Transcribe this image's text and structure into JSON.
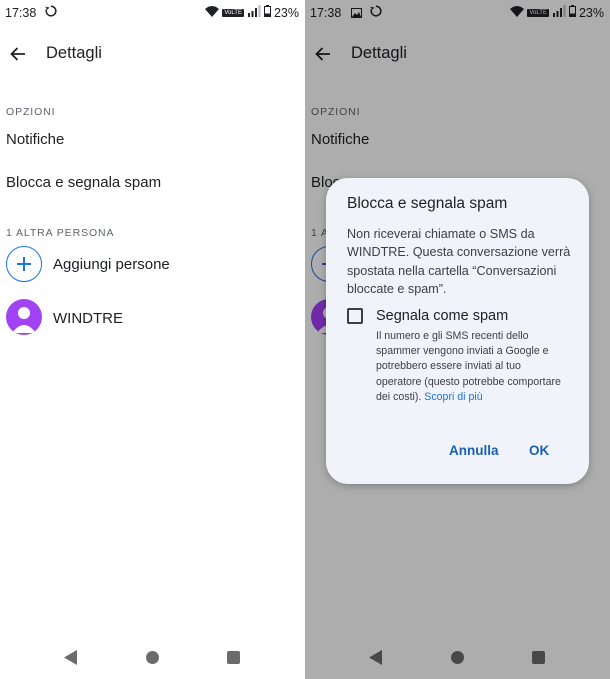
{
  "status_bar": {
    "time": "17:38",
    "battery": "23%",
    "volte": "VoLTE"
  },
  "app_bar": {
    "title": "Dettagli"
  },
  "options": {
    "section_label": "OPZIONI",
    "notifications_label": "Notifiche",
    "block_spam_label": "Blocca e segnala spam",
    "block_spam_partial": "Bloc"
  },
  "people": {
    "section_label": "1 ALTRA PERSONA",
    "section_label_partial": "1 A",
    "add_people_label": "Aggiungi persone",
    "contacts": [
      {
        "name": "WINDTRE"
      }
    ]
  },
  "dialog": {
    "title": "Blocca e segnala spam",
    "body": "Non riceverai chiamate o SMS da WINDTRE. Questa conversazione verrà spostata nella cartella “Conversazioni bloccate e spam”.",
    "report_label": "Segnala come spam",
    "report_checked": false,
    "report_description": "Il numero e gli SMS recenti dello spammer vengono inviati a Google e potrebbero essere inviati al tuo operatore (questo potrebbe comportare dei costi).",
    "learn_more": "Scopri di più",
    "cancel_label": "Annulla",
    "ok_label": "OK"
  },
  "colors": {
    "accent": "#1a73e8",
    "avatar": "#a142f4",
    "dialog_bg": "#f0f4fa",
    "scrim": "rgba(0,0,0,0.32)"
  },
  "icons": [
    "sync-icon",
    "image-icon",
    "wifi-icon",
    "signal-icon",
    "battery-icon",
    "back-arrow-icon",
    "add-icon",
    "person-icon",
    "nav-back-icon",
    "nav-home-icon",
    "nav-recents-icon"
  ]
}
